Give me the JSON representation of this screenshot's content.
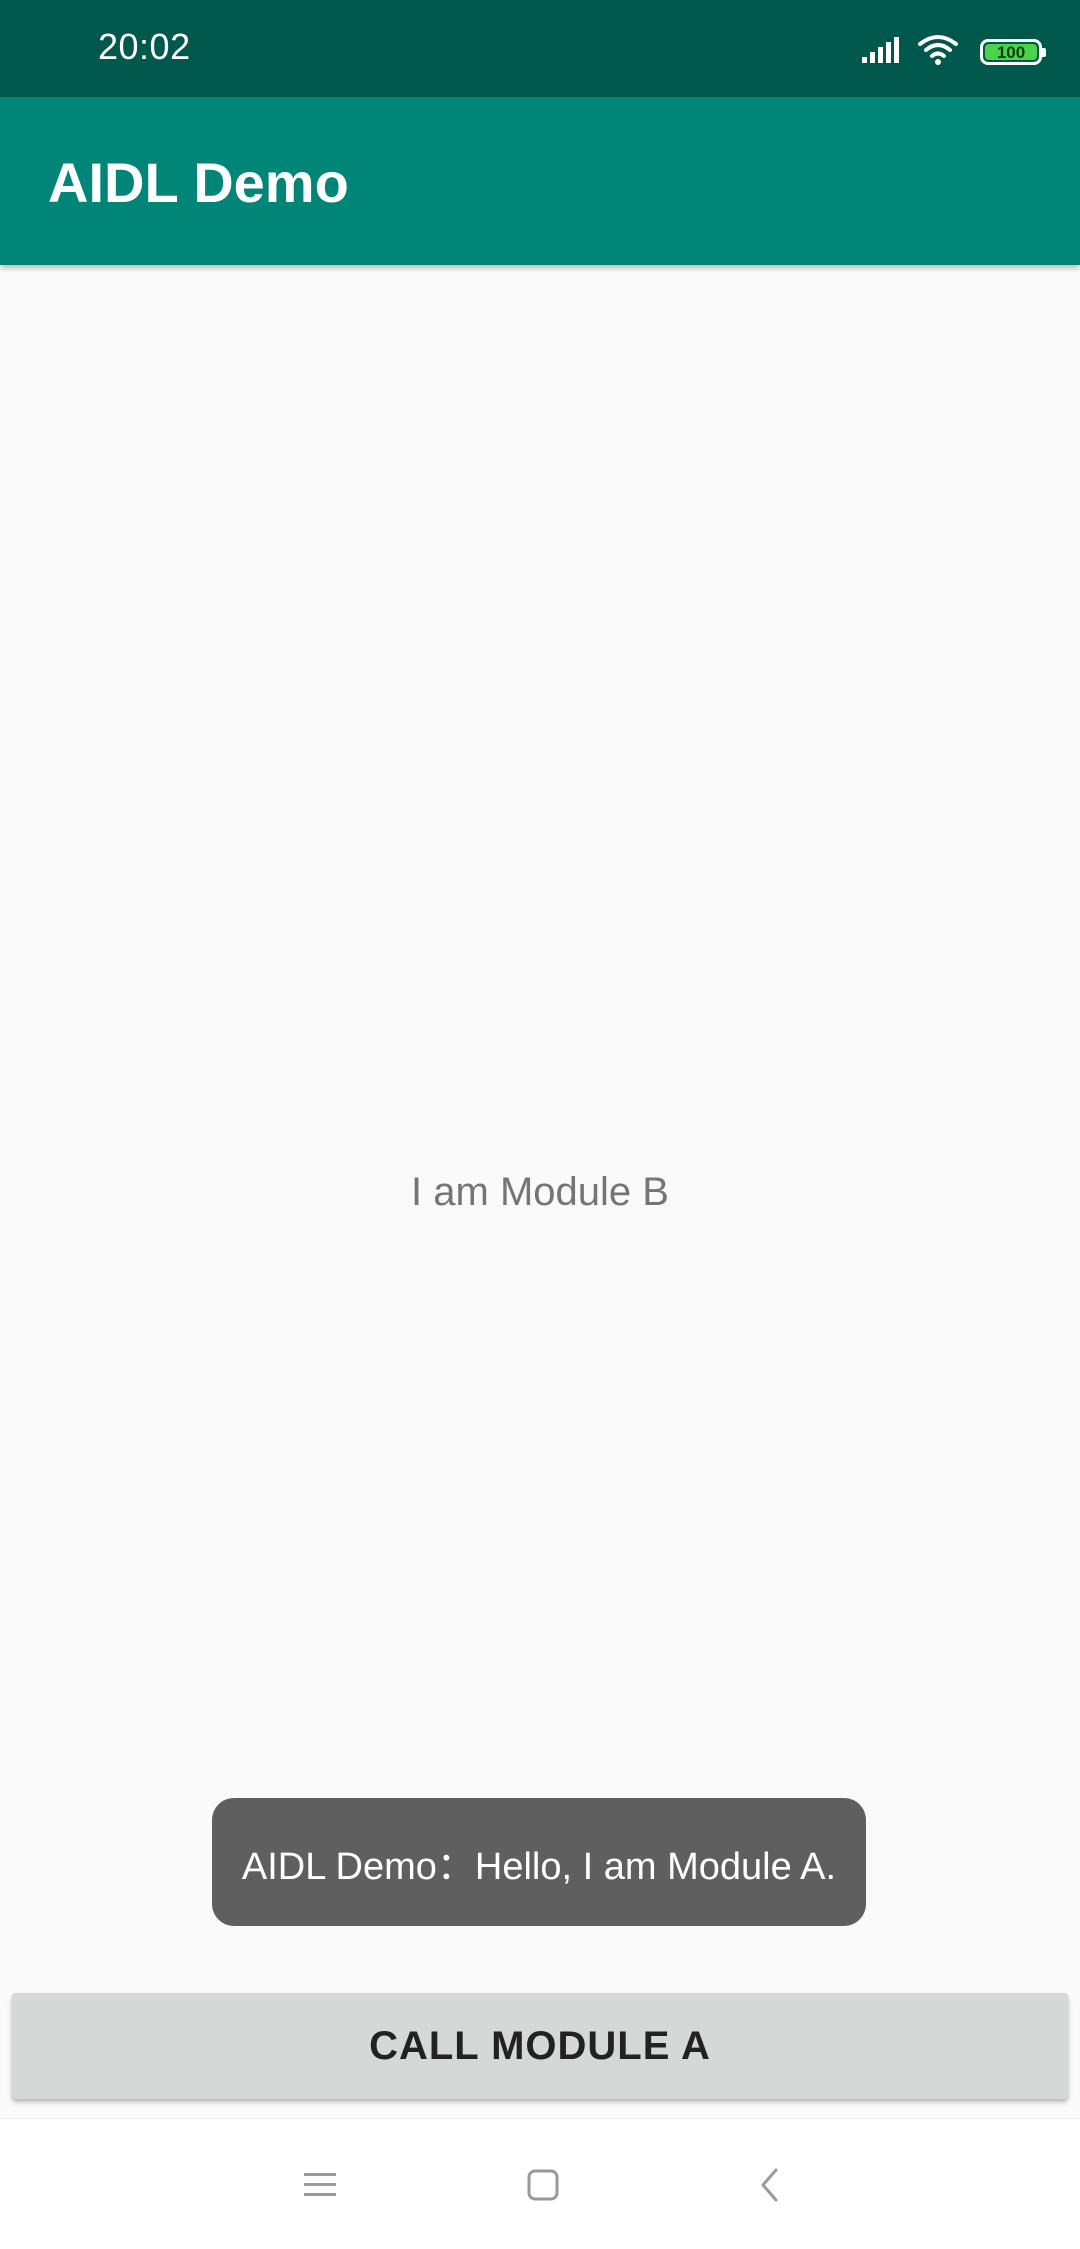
{
  "status_bar": {
    "time": "20:02",
    "battery_level": "100",
    "icons": [
      "signal-icon",
      "wifi-icon",
      "battery-icon"
    ]
  },
  "app_bar": {
    "title": "AIDL Demo"
  },
  "main": {
    "message": "I am Module B"
  },
  "toast": {
    "text": "AIDL Demo：Hello, I am Module A."
  },
  "actions": {
    "call_button_label": "CALL MODULE A"
  },
  "nav_bar": {
    "buttons": [
      "menu-icon",
      "home-icon",
      "back-icon"
    ]
  },
  "colors": {
    "status_bar": "#00574b",
    "app_bar": "#008577",
    "background": "#fafafa",
    "toast": "#5f5f5f",
    "button": "#d6d7d7"
  }
}
